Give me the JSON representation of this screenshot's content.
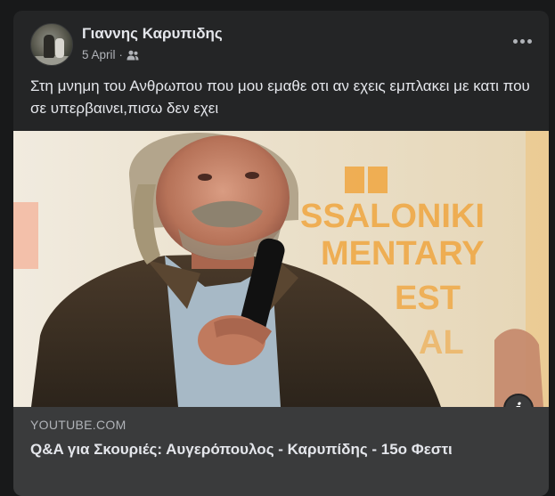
{
  "post": {
    "author": "Γιαννης Καρυπιδης",
    "date": "5 April",
    "separator": "·",
    "audience_icon": "friends-icon",
    "more_icon": "more-horizontal-icon",
    "text": "Στη μνημη του Ανθρωπου που μου εμαθε οτι αν εχεις εμπλακει με κατι που σε υπερβαινει,πισω δεν εχει"
  },
  "link": {
    "thumbnail_backdrop_text": [
      "SSALONIKI",
      "MENTARY",
      "EST",
      "AL"
    ],
    "domain": "YOUTUBE.COM",
    "title": "Q&A για Σκουριές: Αυγερόπουλος - Καρυπίδης - 15ο Φεστι",
    "info_icon": "i"
  },
  "colors": {
    "background": "#18191a",
    "card": "#242526",
    "link_footer": "#3a3b3c",
    "primary_text": "#e4e6eb",
    "secondary_text": "#b0b3b8",
    "backdrop_letters": "#f0a640"
  }
}
